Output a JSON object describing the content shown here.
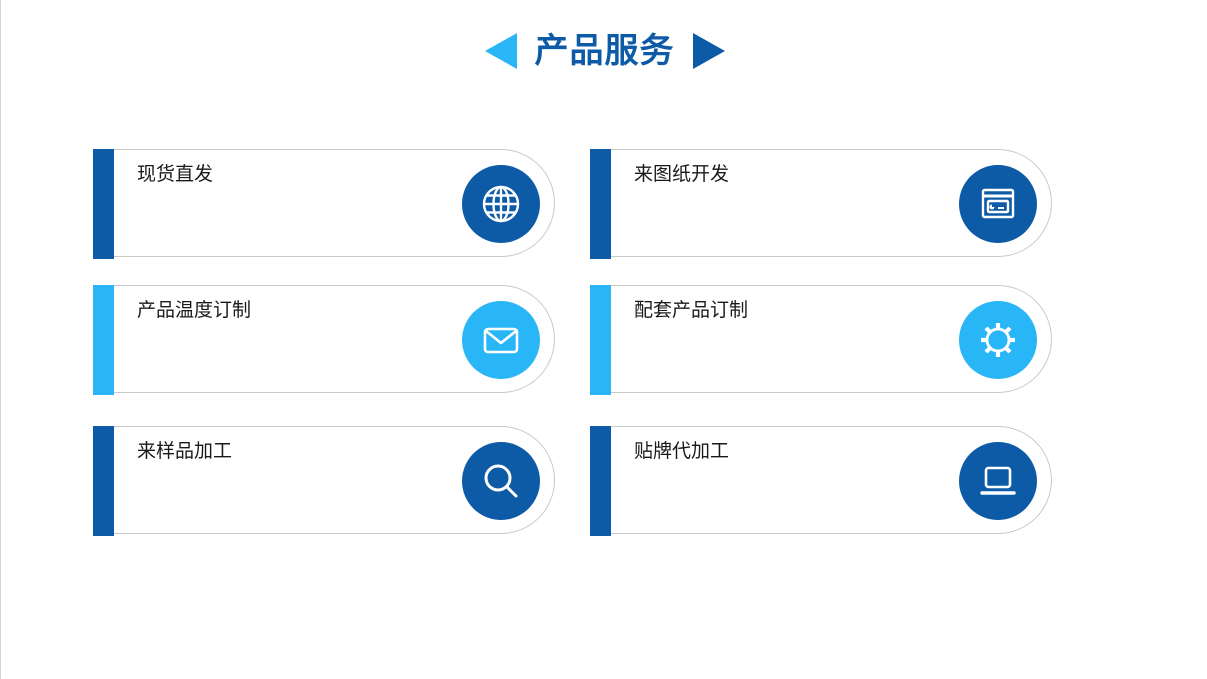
{
  "header": {
    "title": "产品服务"
  },
  "colors": {
    "dark_blue": "#0d5aa7",
    "light_blue": "#29b6f6",
    "card_border": "#c9c9c9"
  },
  "services": [
    {
      "label": "现货直发",
      "icon": "globe-icon",
      "color": "dark"
    },
    {
      "label": "来图纸开发",
      "icon": "id-card-window-icon",
      "color": "dark"
    },
    {
      "label": "产品温度订制",
      "icon": "envelope-icon",
      "color": "light"
    },
    {
      "label": "配套产品订制",
      "icon": "gear-icon",
      "color": "light"
    },
    {
      "label": "来样品加工",
      "icon": "search-icon",
      "color": "dark"
    },
    {
      "label": "贴牌代加工",
      "icon": "laptop-icon",
      "color": "dark"
    }
  ]
}
